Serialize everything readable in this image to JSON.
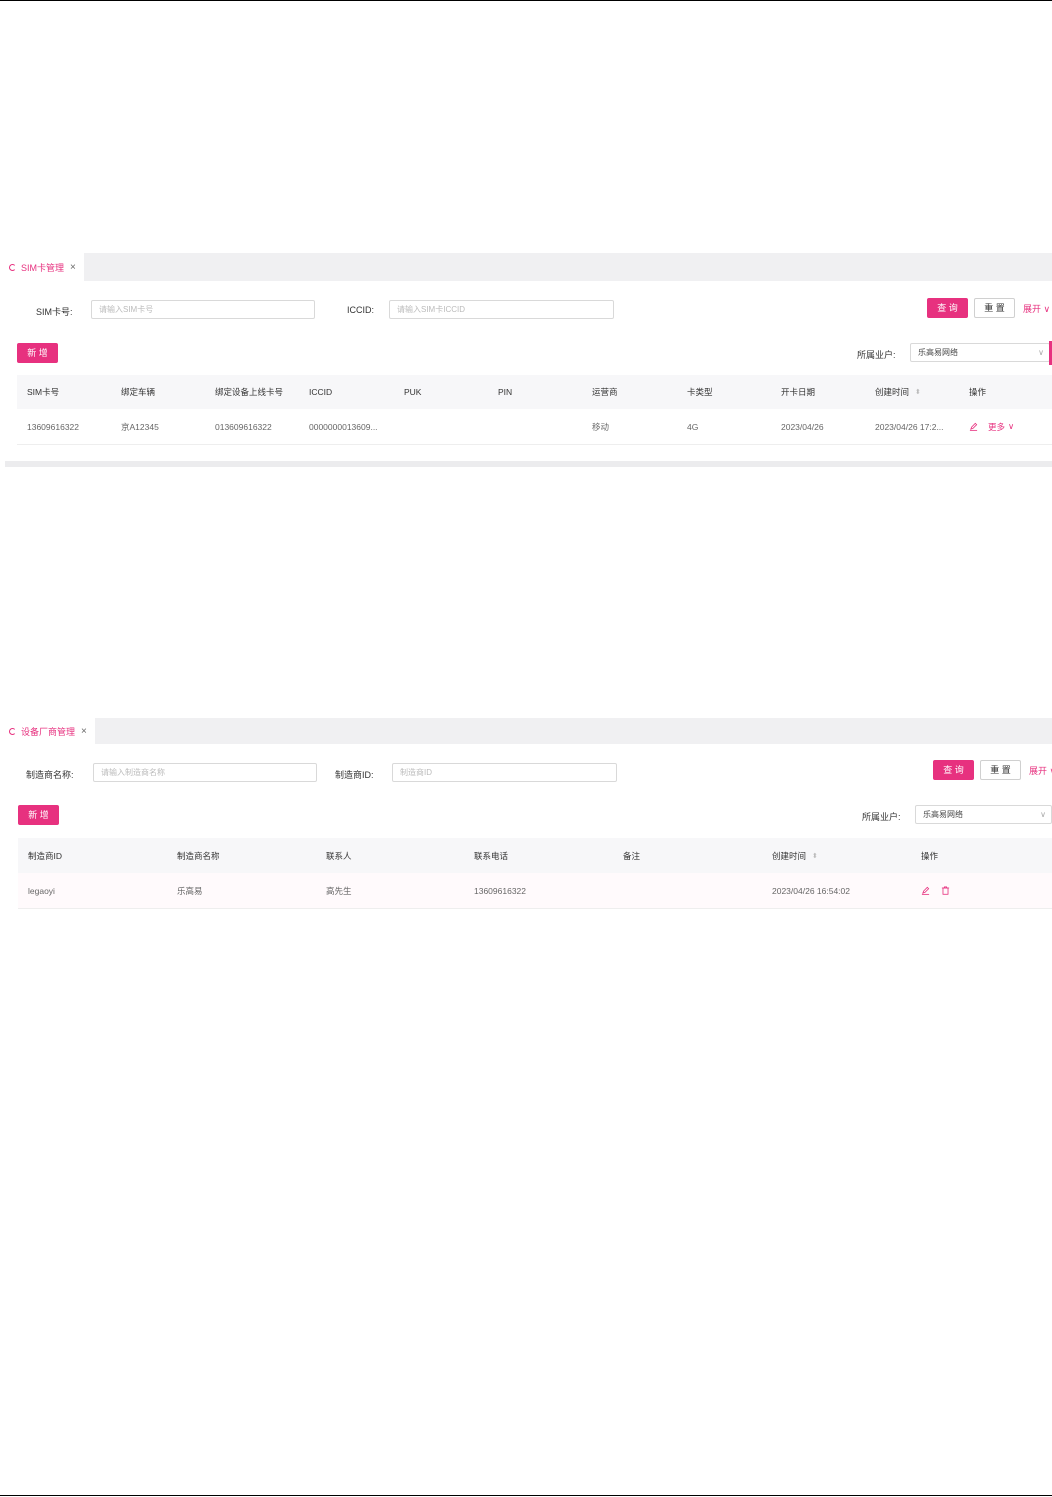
{
  "sim": {
    "tab_label": "SIM卡管理",
    "close": "×",
    "form": {
      "sim_label": "SIM卡号:",
      "sim_placeholder": "请输入SIM卡号",
      "iccid_label": "ICCID:",
      "iccid_placeholder": "请输入SIM卡ICCID",
      "query": "查 询",
      "reset": "重 置",
      "expand": "展开",
      "add": "新 增",
      "tenant_label": "所属业户:",
      "tenant_value": "乐高易网络"
    },
    "columns": [
      "SIM卡号",
      "绑定车辆",
      "绑定设备上线卡号",
      "ICCID",
      "PUK",
      "PIN",
      "运营商",
      "卡类型",
      "开卡日期",
      "创建时间",
      "操作"
    ],
    "row": {
      "sim_no": "13609616322",
      "vehicle": "京A12345",
      "device_card": "013609616322",
      "iccid": "0000000013609...",
      "puk": "",
      "pin": "",
      "carrier": "移动",
      "card_type": "4G",
      "open_date": "2023/04/26",
      "created": "2023/04/26 17:2...",
      "more": "更多"
    }
  },
  "maker": {
    "tab_label": "设备厂商管理",
    "close": "×",
    "form": {
      "name_label": "制造商名称:",
      "name_placeholder": "请输入制造商名称",
      "id_label": "制造商ID:",
      "id_placeholder": "制造商ID",
      "query": "查 询",
      "reset": "重 置",
      "expand": "展开",
      "add": "新 增",
      "tenant_label": "所属业户:",
      "tenant_value": "乐高易网络"
    },
    "columns": [
      "制造商ID",
      "制造商名称",
      "联系人",
      "联系电话",
      "备注",
      "创建时间",
      "操作"
    ],
    "row": {
      "id": "legaoyi",
      "name": "乐高易",
      "contact": "高先生",
      "phone": "13609616322",
      "note": "",
      "created": "2023/04/26 16:54:02"
    }
  },
  "colors": {
    "accent": "#e7317f",
    "tabbar": "#f0f0f2",
    "header": "#f7f7f9"
  }
}
